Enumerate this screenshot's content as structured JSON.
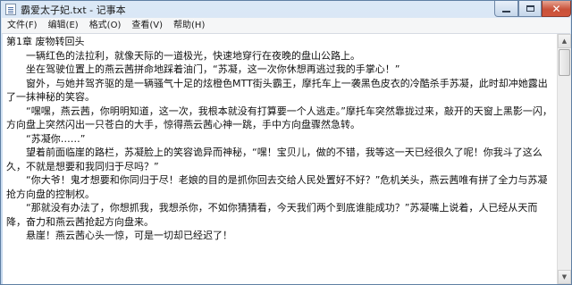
{
  "window": {
    "title": "霸爱太子妃.txt - 记事本",
    "controls": {
      "minimize_icon": "minimize-icon",
      "maximize_icon": "maximize-icon",
      "close_icon": "close-icon",
      "close_glyph": "✕"
    }
  },
  "menu": {
    "items": [
      {
        "label": "文件(F)"
      },
      {
        "label": "编辑(E)"
      },
      {
        "label": "格式(O)"
      },
      {
        "label": "查看(V)"
      },
      {
        "label": "帮助(H)"
      }
    ]
  },
  "document": {
    "paragraphs": [
      "第1章 废物转回头",
      "　　一辆红色的法拉利，就像天际的一道极光，快速地穿行在夜晚的盘山公路上。",
      "　　坐在驾驶位置上的燕云茜拼命地踩着油门，“苏凝，这一次你休想再逃过我的手掌心！”",
      "　　窗外，与她并驾齐驱的是一辆骚气十足的炫橙色MTT街头霸王，摩托车上一袭黑色皮衣的冷酷杀手苏凝，此时却冲她露出了一抹神秘的笑容。",
      "　　“嘿嘿，燕云茜，你明明知道，这一次，我根本就没有打算要一个人逃走。”摩托车突然靠拢过来，敲开的天窗上黑影一闪，方向盘上突然闪出一只苍白的大手，惊得燕云茜心神一跳，手中方向盘骤然急转。",
      "　　“苏凝你……”",
      "　　望着前面临崖的路栏，苏凝脸上的笑容诡异而神秘，“嘿！宝贝儿，做的不错，我等这一天已经很久了呢！你我斗了这么久，不就是想要和我同归于尽吗？”",
      "　　“你大爷！鬼才想要和你同归于尽！老娘的目的是抓你回去交给人民处置好不好？”危机关头，燕云茜唯有拼了全力与苏凝抢方向盘的控制权。",
      "　　“那就没有办法了，你想抓我，我想杀你，不如你猜猜看，今天我们两个到底谁能成功？”苏凝嘴上说着，人已经从天而降，奋力和燕云茜抢起方向盘来。",
      "　　悬崖！燕云茜心头一惊，可是一切却已经迟了！"
    ]
  }
}
